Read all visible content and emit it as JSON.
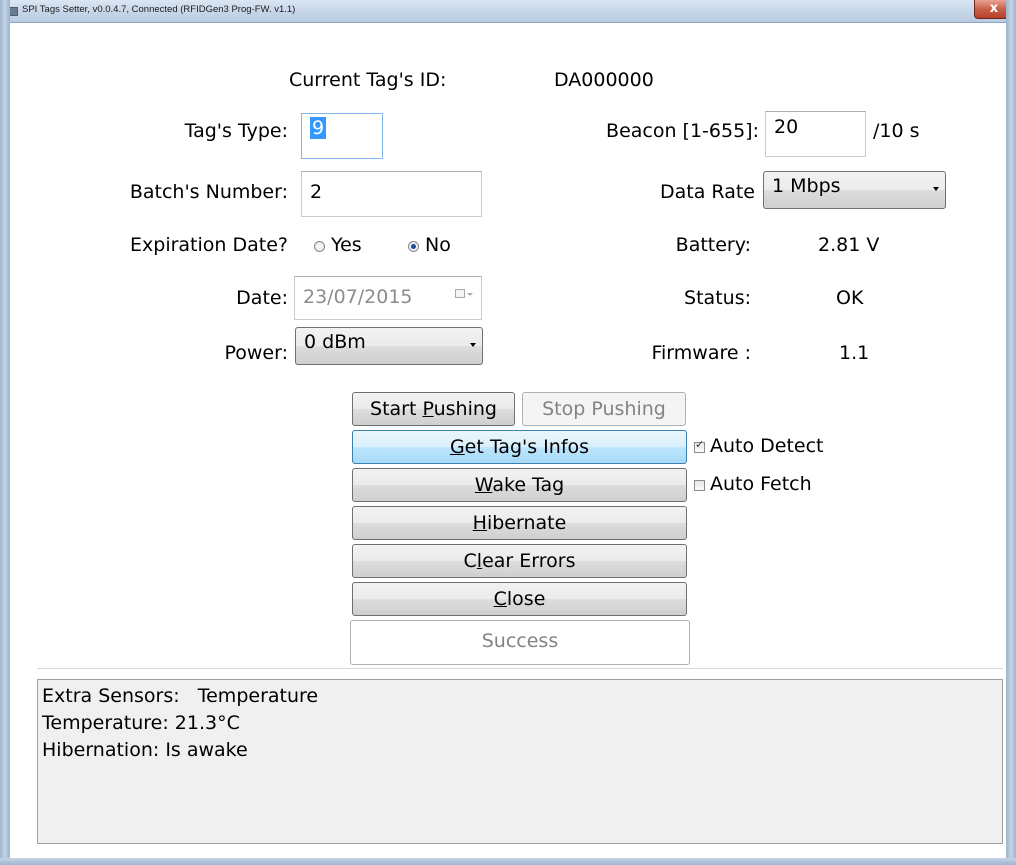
{
  "window": {
    "title": "SPI Tags Setter, v0.0.4.7, Connected (RFIDGen3 Prog-FW. v1.1)",
    "close_glyph": "x"
  },
  "form": {
    "current_id_label": "Current Tag's ID:",
    "current_id_value": "DA000000",
    "tag_type_label": "Tag's Type:",
    "tag_type_value": "9",
    "batch_label": "Batch's Number:",
    "batch_value": "2",
    "expiration_label": "Expiration Date?",
    "expiration_yes": "Yes",
    "expiration_no": "No",
    "expiration_selected": "No",
    "date_label": "Date:",
    "date_value": "23/07/2015",
    "power_label": "Power:",
    "power_value": "0 dBm",
    "beacon_label": "Beacon [1-655]:",
    "beacon_value": "20",
    "beacon_unit": "/10  s",
    "data_rate_label": "Data Rate",
    "data_rate_value": "1 Mbps",
    "battery_label": "Battery:",
    "battery_value": "2.81 V",
    "status_label": "Status:",
    "status_value": "OK",
    "firmware_label": "Firmware :",
    "firmware_value": "1.1"
  },
  "buttons": {
    "start_pushing_pre": "Start ",
    "start_pushing_u": "P",
    "start_pushing_post": "ushing",
    "stop_pushing": "Stop Pushing",
    "get_infos_u": "G",
    "get_infos_post": "et Tag's Infos",
    "wake_u": "W",
    "wake_post": "ake Tag",
    "hibernate_u": "H",
    "hibernate_post": "ibernate",
    "clear_pre": "C",
    "clear_u": "l",
    "clear_post": "ear Errors",
    "close_u": "C",
    "close_post": "lose",
    "success": "Success"
  },
  "checkboxes": {
    "auto_detect": "Auto Detect",
    "auto_detect_checked": true,
    "auto_fetch": "Auto Fetch",
    "auto_fetch_checked": false
  },
  "log": {
    "line1": "Extra Sensors:   Temperature",
    "line2": "Temperature: 21.3°C",
    "line3": "Hibernation: Is awake"
  }
}
